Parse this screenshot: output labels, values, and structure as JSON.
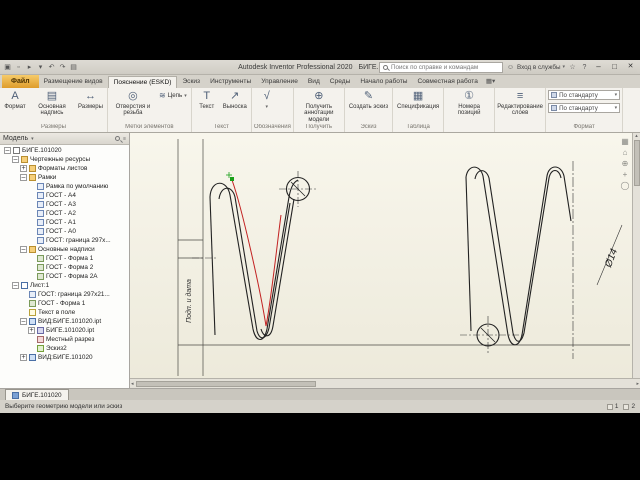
{
  "colors": {
    "file_tab_orange": "#de9c2c",
    "sketch_red": "#c22222",
    "sketch_green": "#19a019",
    "canvas_cream": "#f4f1e3"
  },
  "title_bar": {
    "title": "Autodesk Inventor Professional 2020",
    "document": "БИГЕ.101020",
    "search_placeholder": "Поиск по справке и командам",
    "sign_in_label": "Вход в службы",
    "qat": [
      "app-menu-icon",
      "new-file-icon",
      "open-file-icon",
      "save-icon",
      "undo-icon",
      "redo-icon",
      "print-icon"
    ]
  },
  "ribbon": {
    "file_tab": "Файл",
    "tabs": [
      {
        "label": "Размещение видов",
        "name": "tab-place-views",
        "active": false
      },
      {
        "label": "Пояснение (ESKD)",
        "name": "tab-annotate-eskd",
        "active": true
      },
      {
        "label": "Эскиз",
        "name": "tab-sketch",
        "active": false
      },
      {
        "label": "Инструменты",
        "name": "tab-tools",
        "active": false
      },
      {
        "label": "Управление",
        "name": "tab-manage",
        "active": false
      },
      {
        "label": "Вид",
        "name": "tab-view",
        "active": false
      },
      {
        "label": "Среды",
        "name": "tab-environments",
        "active": false
      },
      {
        "label": "Начало работы",
        "name": "tab-get-started",
        "active": false
      },
      {
        "label": "Совместная работа",
        "name": "tab-collaborate",
        "active": false
      }
    ],
    "groups": [
      {
        "label": "Размеры",
        "buttons": [
          {
            "label": "Формат",
            "name": "format-button",
            "icon": "format-icon"
          },
          {
            "label": "Основная надпись",
            "name": "titleblock-button",
            "icon": "titleblock-icon"
          },
          {
            "label": "Размеры",
            "name": "dimension-button",
            "icon": "dimension-icon"
          }
        ]
      },
      {
        "label": "Метки элементов",
        "buttons": [
          {
            "label": "Отверстия и резьба",
            "name": "hole-thread-button",
            "icon": "hole-thread-icon"
          },
          {
            "label": "Цепь",
            "name": "chain-dimension-button",
            "icon": "chain-icon",
            "small": true,
            "dropdown": true
          }
        ]
      },
      {
        "label": "Текст",
        "buttons": [
          {
            "label": "Текст",
            "name": "text-button",
            "icon": "text-icon"
          },
          {
            "label": "Выноска",
            "name": "leader-text-button",
            "icon": "leader-icon"
          }
        ]
      },
      {
        "label": "Обозначения",
        "buttons": [
          {
            "label": "Шероховатость",
            "name": "surface-texture-button",
            "icon": "surface-icon",
            "iconOnly": true,
            "dropdown": true
          }
        ]
      },
      {
        "label": "Получить",
        "buttons": [
          {
            "label": "Получить аннотации модели",
            "name": "retrieve-annotations-button",
            "icon": "annotations-icon"
          }
        ]
      },
      {
        "label": "Эскиз",
        "buttons": [
          {
            "label": "Создать эскиз",
            "name": "create-sketch-button",
            "icon": "sketch-icon"
          }
        ]
      },
      {
        "label": "Таблица",
        "buttons": [
          {
            "label": "Спецификация",
            "name": "parts-list-button",
            "icon": "parts-list-icon"
          }
        ]
      },
      {
        "label": "",
        "buttons": [
          {
            "label": "Номера позиций",
            "name": "balloon-button",
            "icon": "balloon-icon"
          }
        ]
      },
      {
        "label": "",
        "buttons": [
          {
            "label": "Редактирование слоев",
            "name": "edit-layers-button",
            "icon": "layers-icon"
          }
        ]
      },
      {
        "label": "Формат",
        "buttons": [
          {
            "label": "По стандарту",
            "name": "layer-select",
            "icon": "layer-swatch-icon",
            "select": true
          },
          {
            "label": "По стандарту",
            "name": "style-select",
            "icon": "style-swatch-icon",
            "select": true
          }
        ]
      }
    ]
  },
  "browser": {
    "title": "Модель",
    "tree": [
      {
        "depth": 0,
        "label": "БИГЕ.101020",
        "icon": "drawing",
        "exp": "minus"
      },
      {
        "depth": 1,
        "label": "Чертежные ресурсы",
        "icon": "folder",
        "exp": "minus"
      },
      {
        "depth": 2,
        "label": "Форматы листов",
        "icon": "folder",
        "exp": "plus"
      },
      {
        "depth": 2,
        "label": "Рамки",
        "icon": "folder",
        "exp": "minus"
      },
      {
        "depth": 3,
        "label": "Рамка по умолчанию",
        "icon": "border",
        "exp": null
      },
      {
        "depth": 3,
        "label": "ГОСТ - A4",
        "icon": "border",
        "exp": null
      },
      {
        "depth": 3,
        "label": "ГОСТ - A3",
        "icon": "border",
        "exp": null
      },
      {
        "depth": 3,
        "label": "ГОСТ - A2",
        "icon": "border",
        "exp": null
      },
      {
        "depth": 3,
        "label": "ГОСТ - A1",
        "icon": "border",
        "exp": null
      },
      {
        "depth": 3,
        "label": "ГОСТ - A0",
        "icon": "border",
        "exp": null
      },
      {
        "depth": 3,
        "label": "ГОСТ: граница 297x...",
        "icon": "border",
        "exp": null
      },
      {
        "depth": 2,
        "label": "Основные надписи",
        "icon": "folder",
        "exp": "minus"
      },
      {
        "depth": 3,
        "label": "ГОСТ - Форма 1",
        "icon": "titleblock",
        "exp": null
      },
      {
        "depth": 3,
        "label": "ГОСТ - Форма 2",
        "icon": "titleblock",
        "exp": null
      },
      {
        "depth": 3,
        "label": "ГОСТ - Форма 2А",
        "icon": "titleblock",
        "exp": null
      },
      {
        "depth": 1,
        "label": "Лист:1",
        "icon": "sheet",
        "exp": "minus"
      },
      {
        "depth": 2,
        "label": "ГОСТ: граница 297x21...",
        "icon": "border",
        "exp": null
      },
      {
        "depth": 2,
        "label": "ГОСТ - Форма 1",
        "icon": "titleblock",
        "exp": null
      },
      {
        "depth": 2,
        "label": "Текст в поле",
        "icon": "text",
        "exp": null
      },
      {
        "depth": 2,
        "label": "ВИД:БИГЕ.101020.ipt",
        "icon": "view",
        "exp": "minus"
      },
      {
        "depth": 3,
        "label": "БИГЕ.101020.ipt",
        "icon": "part",
        "exp": "plus"
      },
      {
        "depth": 3,
        "label": "Местный разрез",
        "icon": "section",
        "exp": null
      },
      {
        "depth": 3,
        "label": "Эскиз2",
        "icon": "sketch",
        "exp": null
      },
      {
        "depth": 2,
        "label": "ВИД:БИГЕ.101020",
        "icon": "view",
        "exp": "plus"
      }
    ]
  },
  "canvas": {
    "nav_icons": [
      "navbar-cube-icon",
      "home-icon",
      "zoom-icon",
      "pan-icon",
      "orbit-icon"
    ]
  },
  "drawing": {
    "diameter_label": "Ø14",
    "side_text": "Подп. и дата"
  },
  "doc_tab": {
    "label": "БИГЕ.101020"
  },
  "status": {
    "message": "Выберите геометрию модели или эскиз",
    "pages": [
      "1",
      "2"
    ]
  }
}
